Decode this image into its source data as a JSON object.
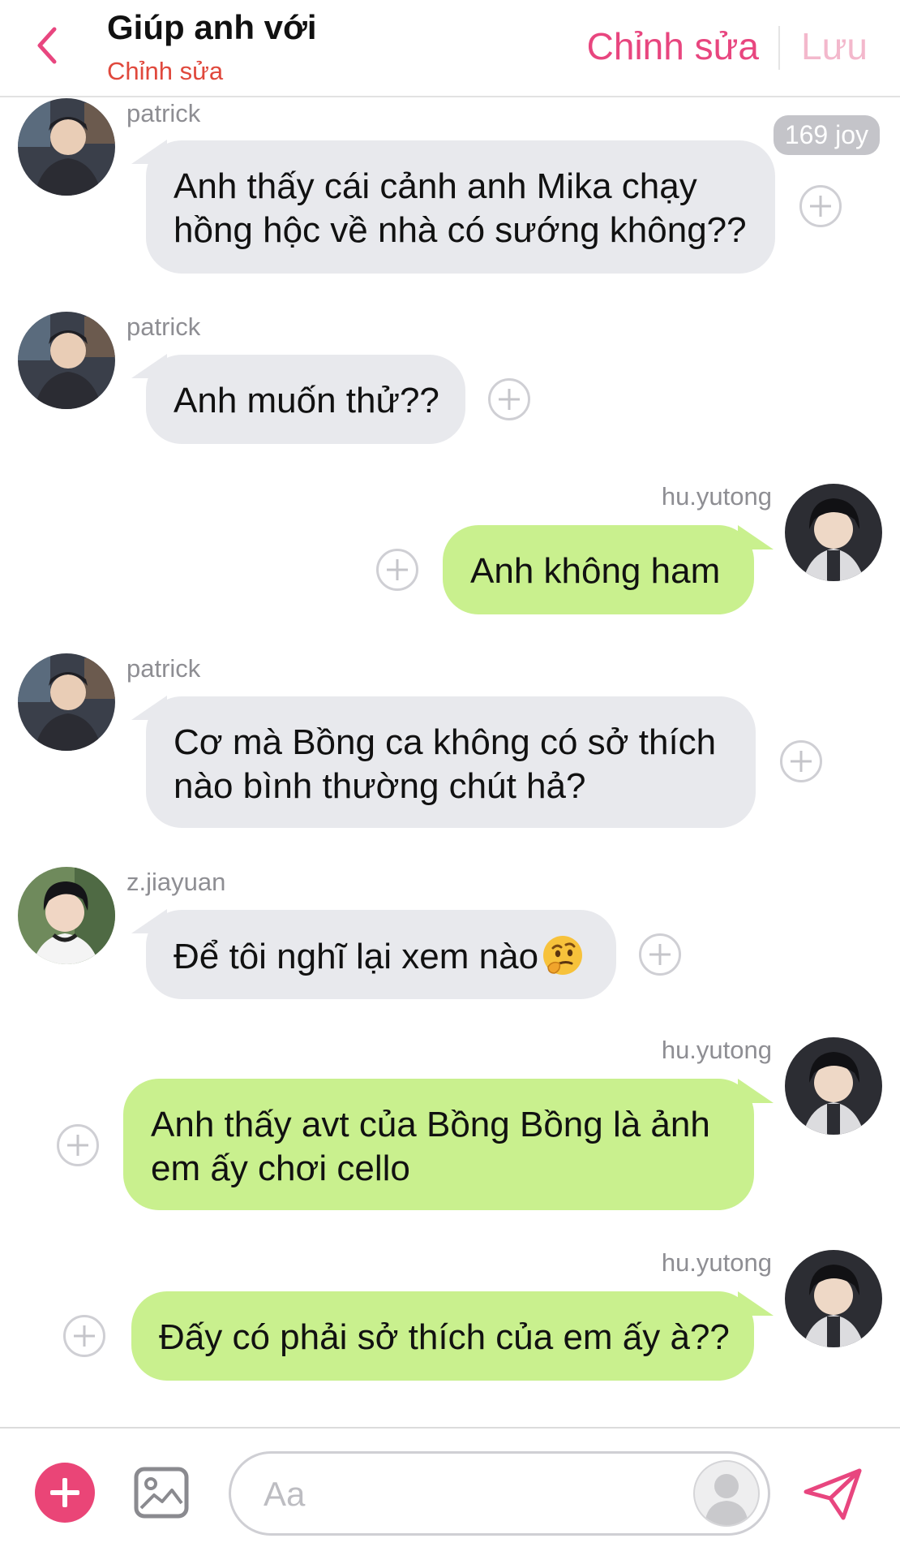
{
  "header": {
    "title": "Giúp anh với",
    "subtitle": "Chỉnh sửa",
    "edit_label": "Chỉnh sửa",
    "save_label": "Lưu",
    "accent": "#e8467f"
  },
  "joy_badge": "169 joy",
  "messages": [
    {
      "sender": "patrick",
      "side": "left",
      "lines": [
        "Anh thấy cái cảnh anh Mika chạy",
        "hồng hộc về nhà có sướng không??"
      ]
    },
    {
      "sender": "patrick",
      "side": "left",
      "lines": [
        "Anh muốn thử??"
      ]
    },
    {
      "sender": "hu.yutong",
      "side": "right",
      "lines": [
        "Anh không ham"
      ]
    },
    {
      "sender": "patrick",
      "side": "left",
      "lines": [
        "Cơ mà Bồng ca không có sở thích",
        "nào bình thường chút hả?"
      ]
    },
    {
      "sender": "z.jiayuan",
      "side": "left",
      "lines": [
        "Để tôi nghĩ lại xem nào"
      ]
    },
    {
      "sender": "hu.yutong",
      "side": "right",
      "lines": [
        "Anh thấy avt của Bồng Bồng là ảnh",
        "em ấy chơi cello"
      ]
    },
    {
      "sender": "hu.yutong",
      "side": "right",
      "lines": [
        "Đấy có phải sở thích của em ấy à??"
      ]
    }
  ],
  "composer": {
    "placeholder": "Aa"
  },
  "colors": {
    "incoming_bubble": "#e8e9ed",
    "outgoing_bubble": "#c9f08e",
    "save_disabled": "#f3b8cc"
  }
}
